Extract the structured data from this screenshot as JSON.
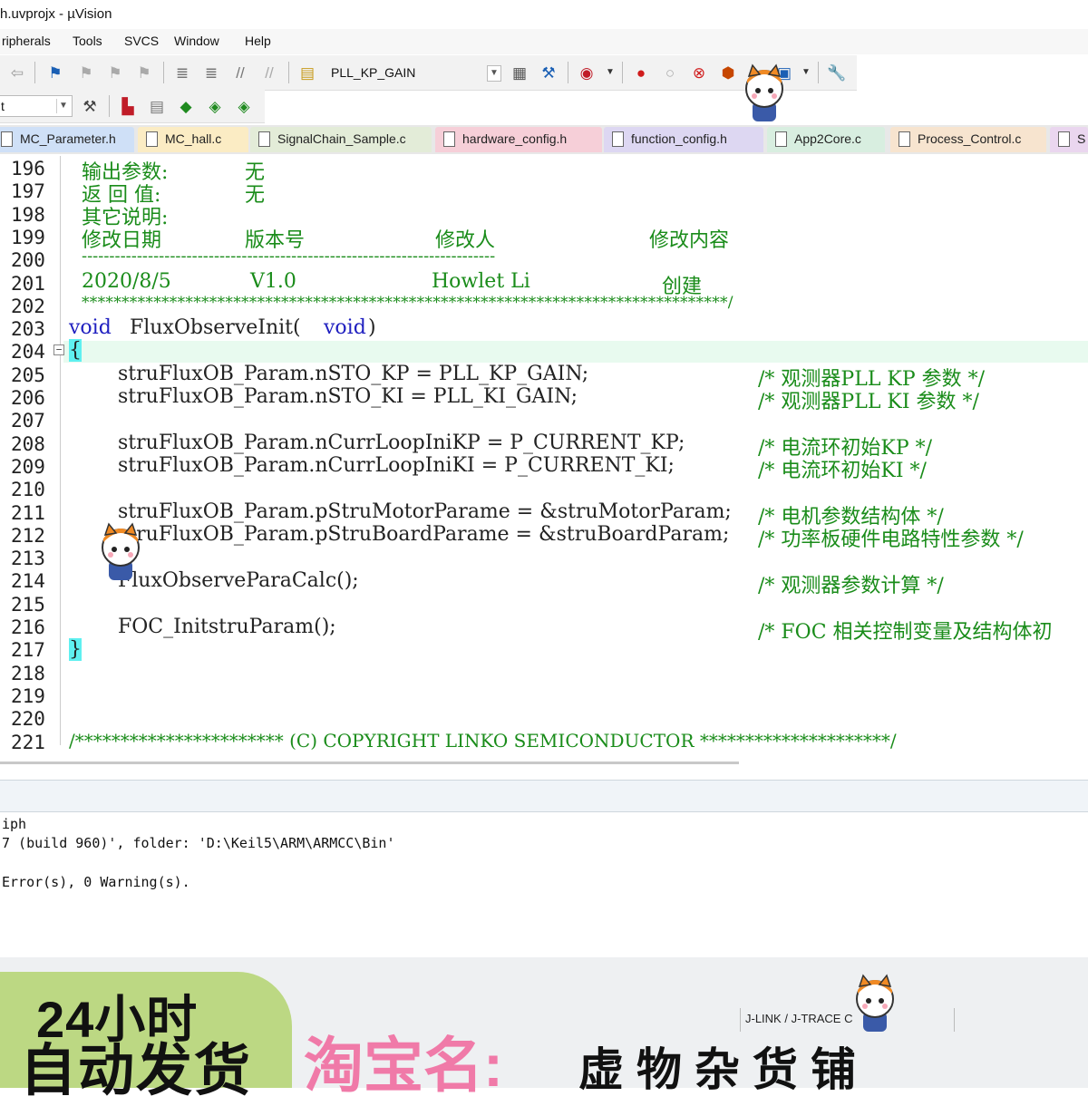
{
  "window": {
    "title": "h.uvprojx - µVision"
  },
  "menu": [
    "ripherals",
    "Tools",
    "SVCS",
    "Window",
    "Help"
  ],
  "toolbar": {
    "target_combo": "PLL_KP_GAIN",
    "target2_combo": "t"
  },
  "tabs": [
    {
      "label": "MC_Parameter.h",
      "color": "#cfe0f7"
    },
    {
      "label": "MC_hall.c",
      "color": "#fbecc4"
    },
    {
      "label": "SignalChain_Sample.c",
      "color": "#e3ecd8"
    },
    {
      "label": "hardware_config.h",
      "color": "#f6cfd8"
    },
    {
      "label": "function_config.h",
      "color": "#ddd7f2"
    },
    {
      "label": "App2Core.c",
      "color": "#d8eee0"
    },
    {
      "label": "Process_Control.c",
      "color": "#f7e4cf"
    },
    {
      "label": "S",
      "color": "#ead6ef"
    }
  ],
  "editor": {
    "line_numbers": [
      "196",
      "197",
      "198",
      "199",
      "200",
      "201",
      "202",
      "203",
      "204",
      "205",
      "206",
      "207",
      "208",
      "209",
      "210",
      "211",
      "212",
      "213",
      "214",
      "215",
      "216",
      "217",
      "218",
      "219",
      "220",
      "221"
    ],
    "header": {
      "output_label": "输出参数:",
      "output_value": "无",
      "return_label": "返 回 值:",
      "return_value": "无",
      "other_label": "其它说明:",
      "col_date": "修改日期",
      "col_version": "版本号",
      "col_author": "修改人",
      "col_content": "修改内容",
      "dash_line": "---------------------------------------------------------------------------",
      "row_date": "2020/8/5",
      "row_version": "V1.0",
      "row_author": "Howlet Li",
      "row_content": "创建",
      "star_line": "*********************************************************************************/"
    },
    "func_void": "void",
    "func_name": "FluxObserveInit(",
    "func_param": "void",
    "func_close": ")",
    "brace_open": "{",
    "brace_close": "}",
    "stmts": {
      "s205": "struFluxOB_Param.nSTO_KP = PLL_KP_GAIN;",
      "s206": "struFluxOB_Param.nSTO_KI = PLL_KI_GAIN;",
      "s208": "struFluxOB_Param.nCurrLoopIniKP = P_CURRENT_KP;",
      "s209": "struFluxOB_Param.nCurrLoopIniKI = P_CURRENT_KI;",
      "s211": "struFluxOB_Param.pStruMotorParame = &struMotorParam;",
      "s212": "struFluxOB_Param.pStruBoardParame = &struBoardParam;",
      "s214": "FluxObserveParaCalc();",
      "s216": "FOC_InitstruParam();"
    },
    "comments": {
      "c205": "/* 观测器PLL KP 参数 */",
      "c206": "/* 观测器PLL KI 参数 */",
      "c208": "/* 电流环初始KP */",
      "c209": "/* 电流环初始KI */",
      "c211": "/* 电机参数结构体 */",
      "c212": "/* 功率板硬件电路特性参数 */",
      "c214": "/* 观测器参数计算 */",
      "c216": "/* FOC 相关控制变量及结构体初"
    },
    "copyright": "/*********************** (C) COPYRIGHT LINKO SEMICONDUCTOR *********************/"
  },
  "build_output": {
    "line1": "iph",
    "line2": "7 (build 960)', folder: 'D:\\Keil5\\ARM\\ARMCC\\Bin'",
    "line3": "Error(s), 0 Warning(s)."
  },
  "status_bar": {
    "debugger": "J-LINK / J-TRACE C"
  },
  "promo": {
    "badge_line1": "24小时",
    "badge_line2": "自动发货",
    "shop_label": "淘宝名:",
    "shop_name": "虚物杂货铺"
  }
}
